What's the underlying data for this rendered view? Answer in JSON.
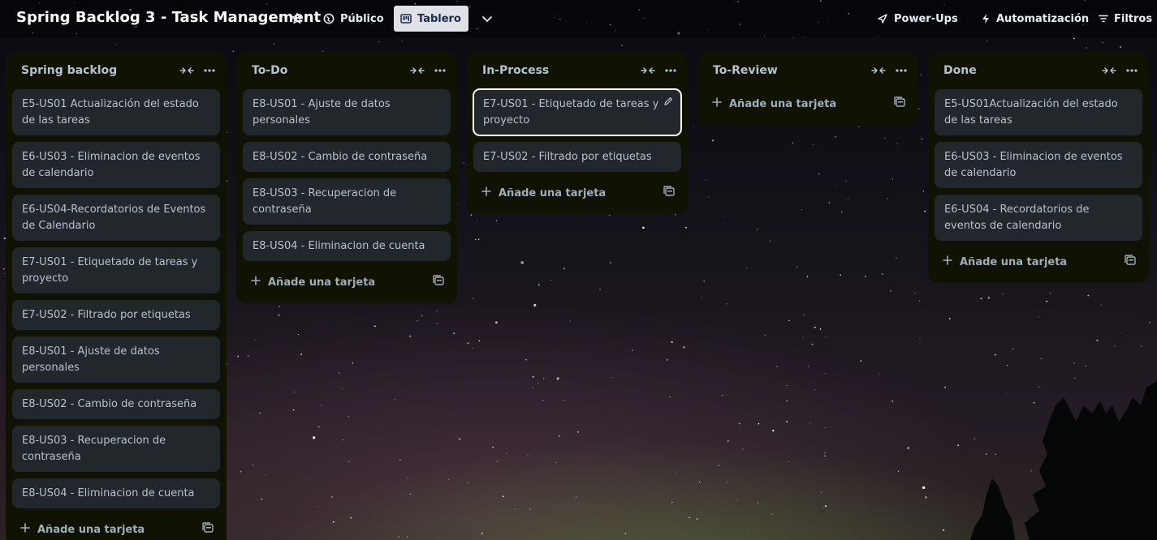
{
  "header": {
    "board_title": "Spring Backlog 3 - Task Management",
    "visibility_label": "Público",
    "view_label": "Tablero",
    "powerups_label": "Power-Ups",
    "automation_label": "Automatización",
    "filters_label": "Filtros"
  },
  "add_card_label": "Añade una tarjeta",
  "lists": [
    {
      "title": "Spring backlog",
      "cards": [
        "E5-US01 Actualización del estado de las tareas",
        "E6-US03 - Eliminacion de eventos de calendario",
        "E6-US04-Recordatorios de Eventos de Calendario",
        "E7-US01 - Etiquetado de tareas y proyecto",
        "E7-US02 - Filtrado por etiquetas",
        "E8-US01 - Ajuste de datos personales",
        "E8-US02 - Cambio de contraseña",
        "E8-US03 - Recuperacion de contraseña",
        "E8-US04 - Eliminacion de cuenta"
      ]
    },
    {
      "title": "To-Do",
      "cards": [
        "E8-US01 - Ajuste de datos personales",
        "E8-US02 - Cambio de contraseña",
        "E8-US03 - Recuperacion de contraseña",
        "E8-US04 - Eliminacion de cuenta"
      ]
    },
    {
      "title": "In-Process",
      "cards": [
        "E7-US01 - Etiquetado de tareas y proyecto",
        "E7-US02 - Filtrado por etiquetas"
      ]
    },
    {
      "title": "To-Review",
      "cards": []
    },
    {
      "title": "Done",
      "cards": [
        "E5-US01Actualización del estado de las tareas",
        "E6-US03 - Eliminacion de eventos de calendario",
        "E6-US04 - Recordatorios de eventos de calendario"
      ]
    }
  ],
  "icons": {
    "star": "star-icon",
    "visibility": "globe-icon",
    "board_view": "board-icon",
    "more_views": "chevron-down-icon",
    "powerups": "rocket-icon",
    "automation": "bolt-icon",
    "filters": "filter-icon",
    "collapse": "collapse-icon",
    "list_menu": "more-icon",
    "add": "plus-icon",
    "template": "template-icon",
    "edit": "pencil-icon"
  },
  "colors": {
    "list_background": "#101204",
    "card_background": "#22272b",
    "text": "#b6c2cf",
    "active_view": "#dfe1e6"
  }
}
